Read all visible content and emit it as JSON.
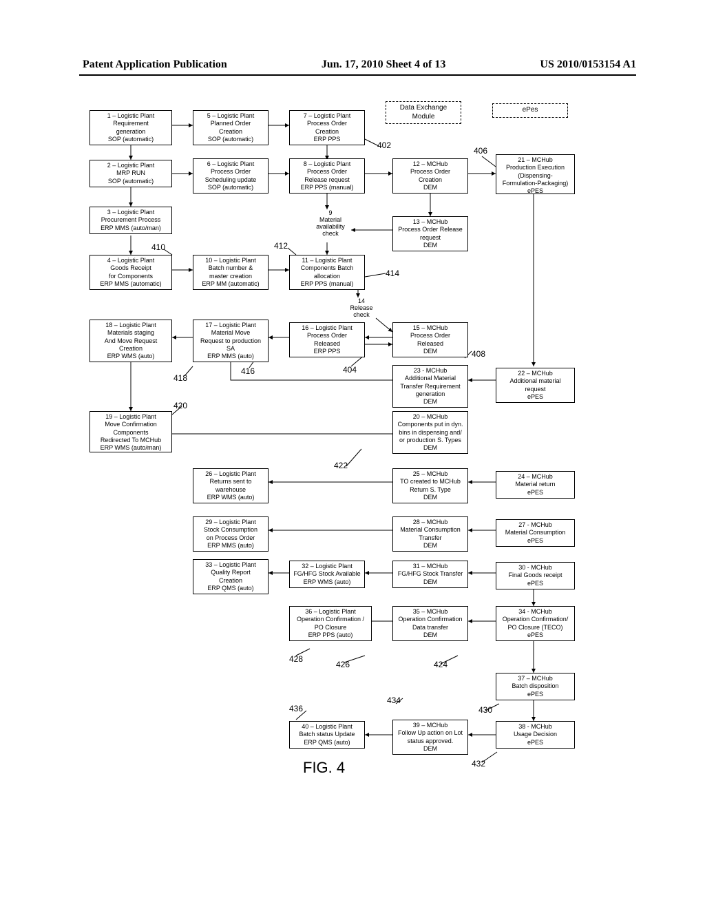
{
  "header": {
    "left": "Patent Application Publication",
    "center": "Jun. 17, 2010  Sheet 4 of 13",
    "right": "US 2010/0153154 A1"
  },
  "dashed": {
    "dem": "Data Exchange\nModule",
    "epes": "ePes"
  },
  "figure_label": "FIG. 4",
  "callouts": {
    "c402": "402",
    "c404": "404",
    "c406": "406",
    "c408": "408",
    "c410": "410",
    "c412": "412",
    "c414": "414",
    "c416": "416",
    "c418": "418",
    "c420": "420",
    "c422": "422",
    "c424": "424",
    "c426": "426",
    "c428": "428",
    "c430": "430",
    "c432": "432",
    "c434": "434",
    "c436": "436"
  },
  "tiny": {
    "n9": "9",
    "mat_avail": "Material\navailability\ncheck",
    "n14": "14",
    "rel_chk": "Release\ncheck"
  },
  "boxes": {
    "b1": "1 – Logistic Plant\nRequirement\ngeneration\nSOP (automatic)",
    "b2": "2 – Logistic Plant\nMRP RUN\nSOP (automatic)",
    "b3": "3 – Logistic Plant\nProcurement Process\nERP MMS (auto/man)",
    "b4": "4 – Logistic Plant\nGoods Receipt\nfor Components\nERP MMS (automatic)",
    "b5": "5 – Logistic Plant\nPlanned Order\nCreation\nSOP (automatic)",
    "b6": "6 – Logistic Plant\nProcess Order\nScheduling update\nSOP (automatic)",
    "b7": "7 – Logistic Plant\nProcess Order\nCreation\nERP PPS",
    "b8": "8 – Logistic Plant\nProcess Order\nRelease request\nERP PPS (manual)",
    "b10": "10 – Logistic Plant\nBatch number &\nmaster creation\nERP MM (automatic)",
    "b11": "11 – Logistic Plant\nComponents Batch\nallocation\nERP PPS (manual)",
    "b12": "12 – MCHub\nProcess Order\nCreation\nDEM",
    "b13": "13 – MCHub\nProcess Order Release\nrequest\nDEM",
    "b15": "15 – MCHub\nProcess Order\nReleased\nDEM",
    "b16": "16 – Logistic Plant\nProcess Order\nReleased\nERP PPS",
    "b17": "17 – Logistic Plant\nMaterial Move\nRequest to production\nSA\nERP MMS (auto)",
    "b18": "18 – Logistic Plant\nMaterials staging\nAnd Move Request\nCreation\nERP WMS (auto)",
    "b19": "19 – Logistic Plant\nMove Confirmation\nComponents\nRedirected To MCHub\nERP WMS (auto/man)",
    "b20": "20 – MCHub\nComponents put in dyn.\nbins in dispensing and/\nor production S. Types\nDEM",
    "b21": "21 – MCHub\nProduction Execution\n(Dispensing-\nFormulation-Packaging)\nePES",
    "b22": "22 – MCHub\nAdditional material\nrequest\nePES",
    "b23": "23 - MCHub\nAdditional Material\nTransfer Requirement\ngeneration\nDEM",
    "b24": "24 – MCHub\nMaterial return\nePES",
    "b25": "25 – MCHub\nTO created to MCHub\nReturn S. Type\nDEM",
    "b26": "26 – Logistic Plant\nReturns sent to\nwarehouse\nERP WMS (auto)",
    "b27": "27 - MCHub\nMaterial Consumption\nePES",
    "b28": "28 – MCHub\nMaterial Consumption\nTransfer\nDEM",
    "b29": "29 – Logistic Plant\nStock Consumption\non Process Order\nERP MMS (auto)",
    "b30": "30 - MCHub\nFinal Goods receipt\nePES",
    "b31": "31 – MCHub\nFG/HFG Stock Transfer\nDEM",
    "b32": "32 – Logistic Plant\nFG/HFG Stock Available\nERP WMS (auto)",
    "b33": "33 – Logistic Plant\nQuality Report\nCreation\nERP QMS (auto)",
    "b34": "34 - MCHub\nOperation Confirmation/\nPO Closure (TECO)\nePES",
    "b35": "35 – MCHub\nOperation Confirmation\nData transfer\nDEM",
    "b36": "36 – Logistic Plant\nOperation Confirmation /\nPO Closure\nERP PPS (auto)",
    "b37": "37 – MCHub\nBatch disposition\nePES",
    "b38": "38 - MCHub\nUsage Decision\nePES",
    "b39": "39 – MCHub\nFollow Up action on Lot\nstatus approved.\nDEM",
    "b40": "40 – Logistic Plant\nBatch status Update\nERP QMS (auto)"
  }
}
